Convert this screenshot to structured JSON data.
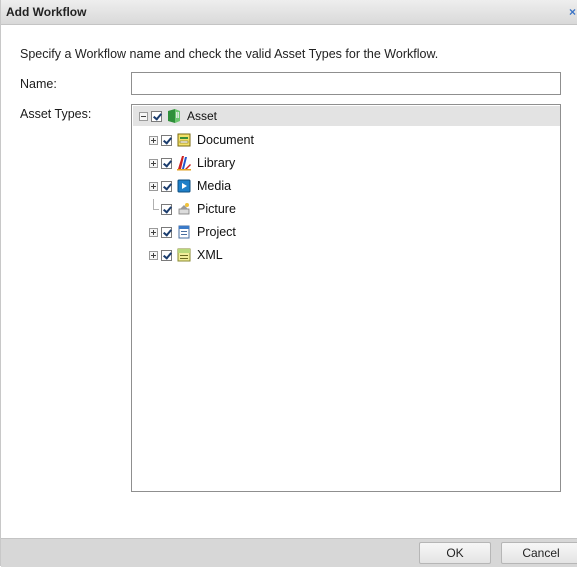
{
  "dialog": {
    "title": "Add Workflow",
    "close_glyph": "×",
    "instructions": "Specify a Workflow name and check the valid Asset Types for the Workflow.",
    "name_label": "Name:",
    "name_value": "",
    "asset_types_label": "Asset Types:"
  },
  "tree": {
    "root": {
      "label": "Asset",
      "icon": "asset-icon",
      "expanded": true,
      "checked": true
    },
    "items": [
      {
        "label": "Document",
        "icon": "document-icon",
        "expandable": true,
        "checked": true
      },
      {
        "label": "Library",
        "icon": "library-icon",
        "expandable": true,
        "checked": true
      },
      {
        "label": "Media",
        "icon": "media-icon",
        "expandable": true,
        "checked": true
      },
      {
        "label": "Picture",
        "icon": "picture-icon",
        "expandable": false,
        "checked": true
      },
      {
        "label": "Project",
        "icon": "project-icon",
        "expandable": true,
        "checked": true
      },
      {
        "label": "XML",
        "icon": "xml-icon",
        "expandable": true,
        "checked": true
      }
    ]
  },
  "footer": {
    "ok_label": "OK",
    "cancel_label": "Cancel"
  },
  "colors": {
    "titlebar": "#e4e4e4",
    "footer": "#d7d7d7",
    "root_row_highlight": "#e3e3e3",
    "close_accent": "#3b74c6"
  }
}
